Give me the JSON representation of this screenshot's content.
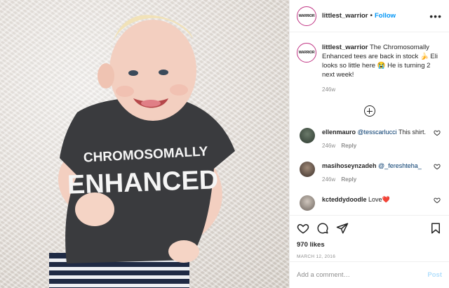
{
  "post": {
    "username": "littlest_warrior",
    "follow_label": "Follow",
    "more_label": "•••",
    "avatar_text": "WARRIOR",
    "caption_user": "littlest_warrior",
    "caption_text": "The Chromosomally Enhanced tees are back in stock 🍌 Eli looks so little here 😭 He is turning 2 next week!",
    "caption_age": "246w",
    "likes": "970 likes",
    "date": "MARCH 12, 2016",
    "add_comment_placeholder": "Add a comment…",
    "post_label": "Post"
  },
  "photo": {
    "shirt_text_line1": "CHROMOSOMALLY",
    "shirt_text_line2": "ENHANCED",
    "colors": {
      "shirt": "#3a3b3e",
      "skin": "#f3cfc0",
      "hair": "#f1e2b8"
    }
  },
  "comments": [
    {
      "user": "ellenmauro",
      "mention": "@tesscarlucci",
      "text": " This shirt.",
      "age": "246w",
      "reply": "Reply"
    },
    {
      "user": "masihoseynzadeh",
      "mention": "@_fereshteha_",
      "text": "",
      "age": "246w",
      "reply": "Reply"
    },
    {
      "user": "kcteddydoodle",
      "mention": "",
      "text": "Love❤️",
      "age": "",
      "reply": ""
    }
  ],
  "colors": {
    "link": "#0095f6",
    "ring": "#c13584",
    "muted": "#8e8e8e"
  }
}
